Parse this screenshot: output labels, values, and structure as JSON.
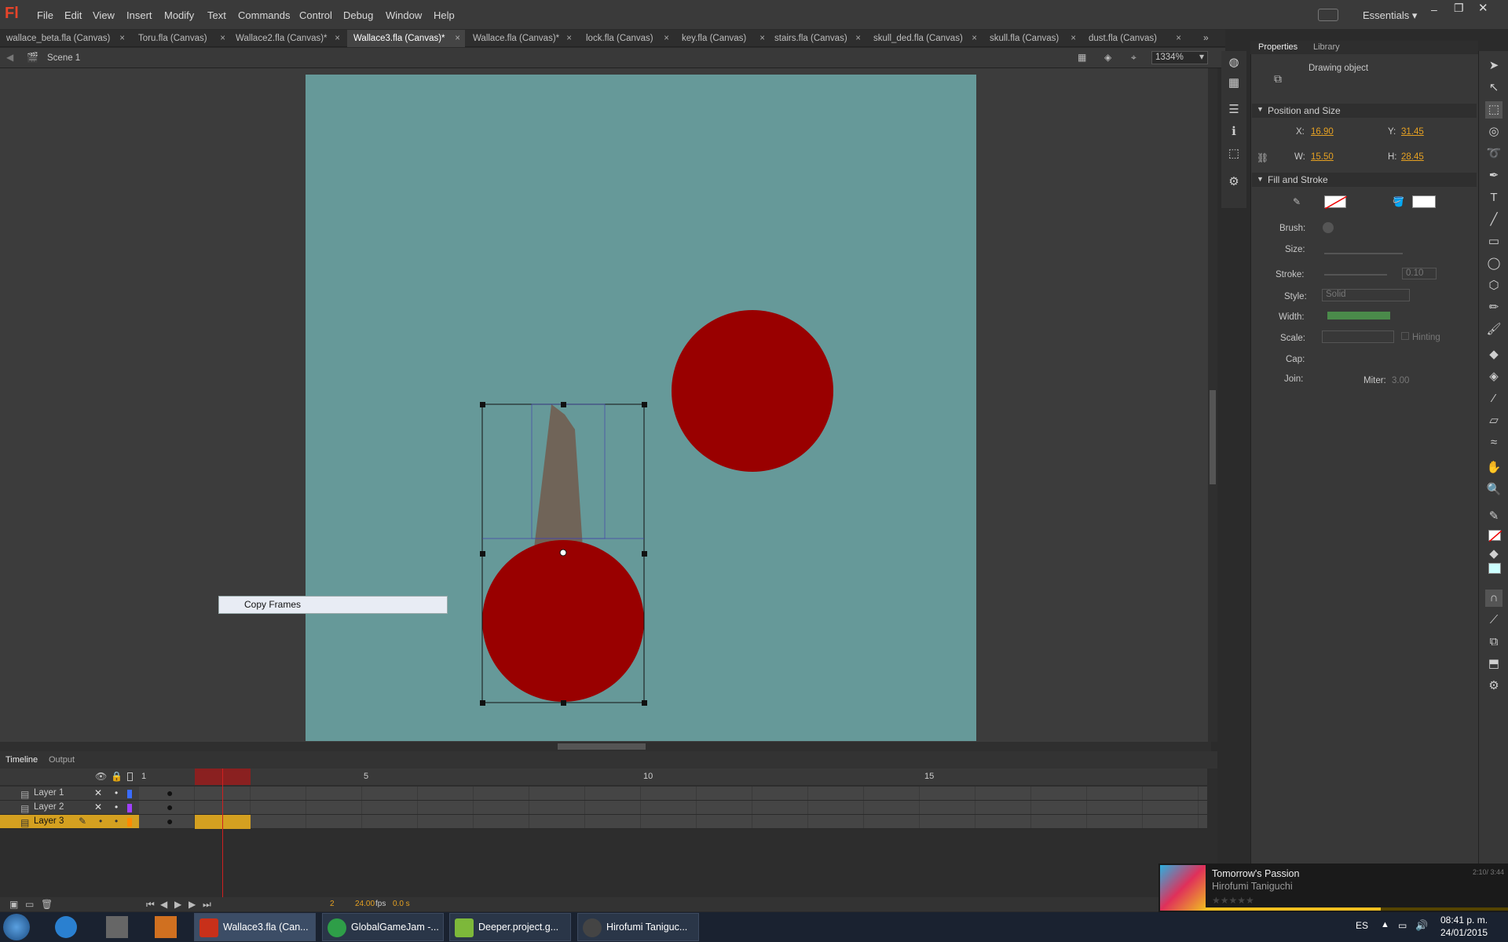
{
  "menubar": {
    "logo": "Fl",
    "items": [
      "File",
      "Edit",
      "View",
      "Insert",
      "Modify",
      "Text",
      "Commands",
      "Control",
      "Debug",
      "Window",
      "Help"
    ],
    "workspace": "Essentials"
  },
  "tabs": [
    {
      "label": "wallace_beta.fla (Canvas)",
      "active": false
    },
    {
      "label": "Toru.fla (Canvas)",
      "active": false
    },
    {
      "label": "Wallace2.fla (Canvas)*",
      "active": false
    },
    {
      "label": "Wallace3.fla (Canvas)*",
      "active": true
    },
    {
      "label": "Wallace.fla (Canvas)*",
      "active": false
    },
    {
      "label": "lock.fla (Canvas)",
      "active": false
    },
    {
      "label": "key.fla (Canvas)",
      "active": false
    },
    {
      "label": "stairs.fla (Canvas)",
      "active": false
    },
    {
      "label": "skull_ded.fla (Canvas)",
      "active": false
    },
    {
      "label": "skull.fla (Canvas)",
      "active": false
    },
    {
      "label": "dust.fla (Canvas)",
      "active": false
    }
  ],
  "scene": {
    "name": "Scene 1",
    "zoom": "1334%"
  },
  "stage": {
    "background": "#669999",
    "shape_fill": "#990000",
    "brush_fill": "#706458"
  },
  "context_menu": {
    "item": "Copy Frames"
  },
  "timeline": {
    "tabs": [
      "Timeline",
      "Output"
    ],
    "frame_numbers": [
      "1",
      "5",
      "10",
      "15"
    ],
    "layers": [
      {
        "name": "Layer 1",
        "color": "#3a6cff",
        "selected": false
      },
      {
        "name": "Layer 2",
        "color": "#a040ff",
        "selected": false
      },
      {
        "name": "Layer 3",
        "color": "#ff8a00",
        "selected": true
      }
    ],
    "current_frame": "2",
    "fps": "24.00",
    "fps_unit": "fps",
    "time": "0.0 s"
  },
  "properties": {
    "tabs": [
      "Properties",
      "Library"
    ],
    "object_type": "Drawing object",
    "position_size_title": "Position and Size",
    "x_label": "X:",
    "x": "16.90",
    "y_label": "Y:",
    "y": "31.45",
    "w_label": "W:",
    "w": "15.50",
    "h_label": "H:",
    "h": "28.45",
    "fill_stroke_title": "Fill and Stroke",
    "brush_label": "Brush:",
    "size_label": "Size:",
    "stroke_label": "Stroke:",
    "stroke": "0.10",
    "style_label": "Style:",
    "style": "Solid",
    "width_label": "Width:",
    "scale_label": "Scale:",
    "hinting_label": "Hinting",
    "cap_label": "Cap:",
    "join_label": "Join:",
    "miter_label": "Miter:",
    "miter": "3.00"
  },
  "music": {
    "title": "Tomorrow's Passion",
    "artist": "Hirofumi Taniguchi",
    "time": "2:10/ 3:44"
  },
  "taskbar": {
    "items": [
      {
        "label": "Wallace3.fla (Can...",
        "color": "#c8301a",
        "active": true
      },
      {
        "label": "GlobalGameJam -...",
        "color": "#2e9e48",
        "active": false
      },
      {
        "label": "Deeper.project.g...",
        "color": "#7db83a",
        "active": false
      },
      {
        "label": "Hirofumi Taniguc...",
        "color": "#444",
        "active": false
      }
    ],
    "language": "ES",
    "clock_time": "08:41 p. m.",
    "clock_date": "24/01/2015"
  }
}
